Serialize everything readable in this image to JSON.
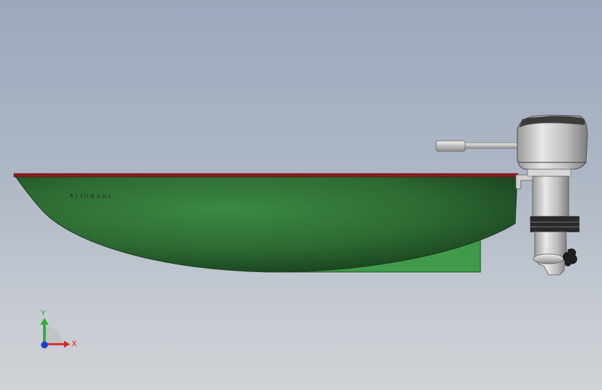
{
  "scene": {
    "hull_text": "ALIGNANI",
    "colors": {
      "hull": "#2f6b34",
      "gunwale": "#8a1e1e",
      "keel_fin": "#3f9a4b",
      "engine_cover": "#c9c9c9",
      "background_top": "#9ba8bd",
      "background_bottom": "#d0d3d7"
    }
  },
  "triad": {
    "y_label": "Y",
    "x_label": "X",
    "colors": {
      "y": "#2fae3a",
      "x": "#d42a2a",
      "z": "#1f3fd6"
    }
  }
}
